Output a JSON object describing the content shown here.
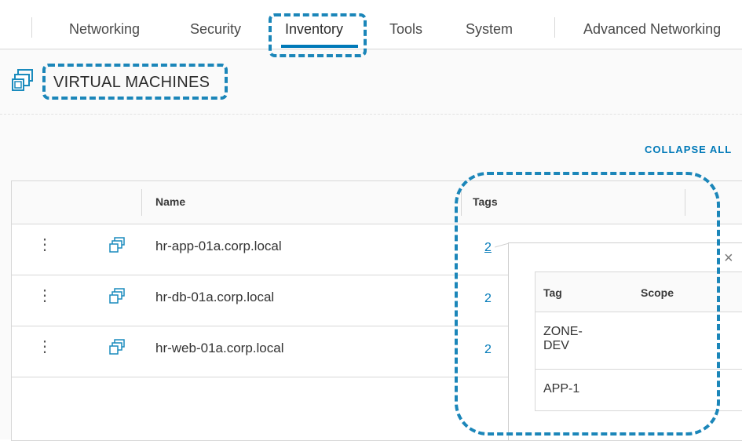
{
  "nav": {
    "tabs": [
      {
        "label": "Networking"
      },
      {
        "label": "Security"
      },
      {
        "label": "Inventory",
        "active": true
      },
      {
        "label": "Tools"
      },
      {
        "label": "System"
      },
      {
        "label": "Advanced Networking"
      }
    ]
  },
  "page": {
    "title": "VIRTUAL MACHINES",
    "collapse_all": "COLLAPSE ALL"
  },
  "table": {
    "columns": {
      "name": "Name",
      "tags": "Tags"
    },
    "rows": [
      {
        "name": "hr-app-01a.corp.local",
        "tags": "2"
      },
      {
        "name": "hr-db-01a.corp.local",
        "tags": "2"
      },
      {
        "name": "hr-web-01a.corp.local",
        "tags": "2"
      }
    ]
  },
  "popover": {
    "close": "×",
    "columns": {
      "tag": "Tag",
      "scope": "Scope"
    },
    "rows": [
      {
        "tag": "ZONE-\nDEV",
        "scope": ""
      },
      {
        "tag": "APP-1",
        "scope": ""
      }
    ]
  },
  "colors": {
    "accent": "#0079b8",
    "callout": "#1b86b9",
    "icon": "#1a8bbd"
  },
  "icons": {
    "row_menu": "vertical-ellipsis-icon",
    "vm": "virtual-machine-icon"
  }
}
